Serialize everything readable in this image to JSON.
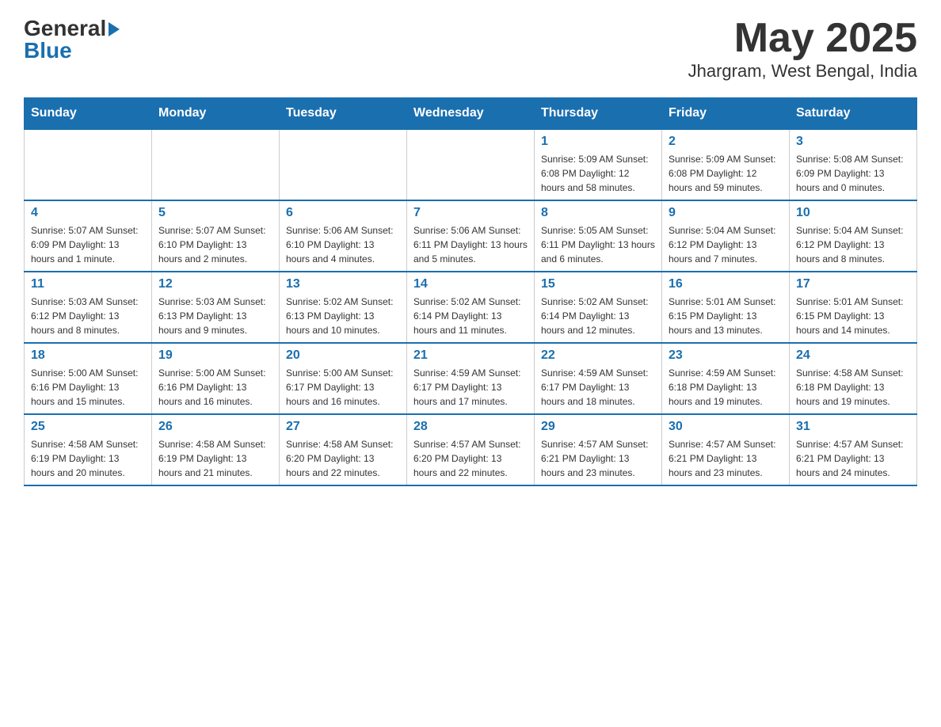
{
  "header": {
    "logo": {
      "general": "General",
      "blue": "Blue",
      "arrow": "▶"
    },
    "month_year": "May 2025",
    "location": "Jhargram, West Bengal, India"
  },
  "calendar": {
    "days_of_week": [
      "Sunday",
      "Monday",
      "Tuesday",
      "Wednesday",
      "Thursday",
      "Friday",
      "Saturday"
    ],
    "weeks": [
      [
        {
          "day": "",
          "info": ""
        },
        {
          "day": "",
          "info": ""
        },
        {
          "day": "",
          "info": ""
        },
        {
          "day": "",
          "info": ""
        },
        {
          "day": "1",
          "info": "Sunrise: 5:09 AM\nSunset: 6:08 PM\nDaylight: 12 hours\nand 58 minutes."
        },
        {
          "day": "2",
          "info": "Sunrise: 5:09 AM\nSunset: 6:08 PM\nDaylight: 12 hours\nand 59 minutes."
        },
        {
          "day": "3",
          "info": "Sunrise: 5:08 AM\nSunset: 6:09 PM\nDaylight: 13 hours\nand 0 minutes."
        }
      ],
      [
        {
          "day": "4",
          "info": "Sunrise: 5:07 AM\nSunset: 6:09 PM\nDaylight: 13 hours\nand 1 minute."
        },
        {
          "day": "5",
          "info": "Sunrise: 5:07 AM\nSunset: 6:10 PM\nDaylight: 13 hours\nand 2 minutes."
        },
        {
          "day": "6",
          "info": "Sunrise: 5:06 AM\nSunset: 6:10 PM\nDaylight: 13 hours\nand 4 minutes."
        },
        {
          "day": "7",
          "info": "Sunrise: 5:06 AM\nSunset: 6:11 PM\nDaylight: 13 hours\nand 5 minutes."
        },
        {
          "day": "8",
          "info": "Sunrise: 5:05 AM\nSunset: 6:11 PM\nDaylight: 13 hours\nand 6 minutes."
        },
        {
          "day": "9",
          "info": "Sunrise: 5:04 AM\nSunset: 6:12 PM\nDaylight: 13 hours\nand 7 minutes."
        },
        {
          "day": "10",
          "info": "Sunrise: 5:04 AM\nSunset: 6:12 PM\nDaylight: 13 hours\nand 8 minutes."
        }
      ],
      [
        {
          "day": "11",
          "info": "Sunrise: 5:03 AM\nSunset: 6:12 PM\nDaylight: 13 hours\nand 8 minutes."
        },
        {
          "day": "12",
          "info": "Sunrise: 5:03 AM\nSunset: 6:13 PM\nDaylight: 13 hours\nand 9 minutes."
        },
        {
          "day": "13",
          "info": "Sunrise: 5:02 AM\nSunset: 6:13 PM\nDaylight: 13 hours\nand 10 minutes."
        },
        {
          "day": "14",
          "info": "Sunrise: 5:02 AM\nSunset: 6:14 PM\nDaylight: 13 hours\nand 11 minutes."
        },
        {
          "day": "15",
          "info": "Sunrise: 5:02 AM\nSunset: 6:14 PM\nDaylight: 13 hours\nand 12 minutes."
        },
        {
          "day": "16",
          "info": "Sunrise: 5:01 AM\nSunset: 6:15 PM\nDaylight: 13 hours\nand 13 minutes."
        },
        {
          "day": "17",
          "info": "Sunrise: 5:01 AM\nSunset: 6:15 PM\nDaylight: 13 hours\nand 14 minutes."
        }
      ],
      [
        {
          "day": "18",
          "info": "Sunrise: 5:00 AM\nSunset: 6:16 PM\nDaylight: 13 hours\nand 15 minutes."
        },
        {
          "day": "19",
          "info": "Sunrise: 5:00 AM\nSunset: 6:16 PM\nDaylight: 13 hours\nand 16 minutes."
        },
        {
          "day": "20",
          "info": "Sunrise: 5:00 AM\nSunset: 6:17 PM\nDaylight: 13 hours\nand 16 minutes."
        },
        {
          "day": "21",
          "info": "Sunrise: 4:59 AM\nSunset: 6:17 PM\nDaylight: 13 hours\nand 17 minutes."
        },
        {
          "day": "22",
          "info": "Sunrise: 4:59 AM\nSunset: 6:17 PM\nDaylight: 13 hours\nand 18 minutes."
        },
        {
          "day": "23",
          "info": "Sunrise: 4:59 AM\nSunset: 6:18 PM\nDaylight: 13 hours\nand 19 minutes."
        },
        {
          "day": "24",
          "info": "Sunrise: 4:58 AM\nSunset: 6:18 PM\nDaylight: 13 hours\nand 19 minutes."
        }
      ],
      [
        {
          "day": "25",
          "info": "Sunrise: 4:58 AM\nSunset: 6:19 PM\nDaylight: 13 hours\nand 20 minutes."
        },
        {
          "day": "26",
          "info": "Sunrise: 4:58 AM\nSunset: 6:19 PM\nDaylight: 13 hours\nand 21 minutes."
        },
        {
          "day": "27",
          "info": "Sunrise: 4:58 AM\nSunset: 6:20 PM\nDaylight: 13 hours\nand 22 minutes."
        },
        {
          "day": "28",
          "info": "Sunrise: 4:57 AM\nSunset: 6:20 PM\nDaylight: 13 hours\nand 22 minutes."
        },
        {
          "day": "29",
          "info": "Sunrise: 4:57 AM\nSunset: 6:21 PM\nDaylight: 13 hours\nand 23 minutes."
        },
        {
          "day": "30",
          "info": "Sunrise: 4:57 AM\nSunset: 6:21 PM\nDaylight: 13 hours\nand 23 minutes."
        },
        {
          "day": "31",
          "info": "Sunrise: 4:57 AM\nSunset: 6:21 PM\nDaylight: 13 hours\nand 24 minutes."
        }
      ]
    ]
  }
}
